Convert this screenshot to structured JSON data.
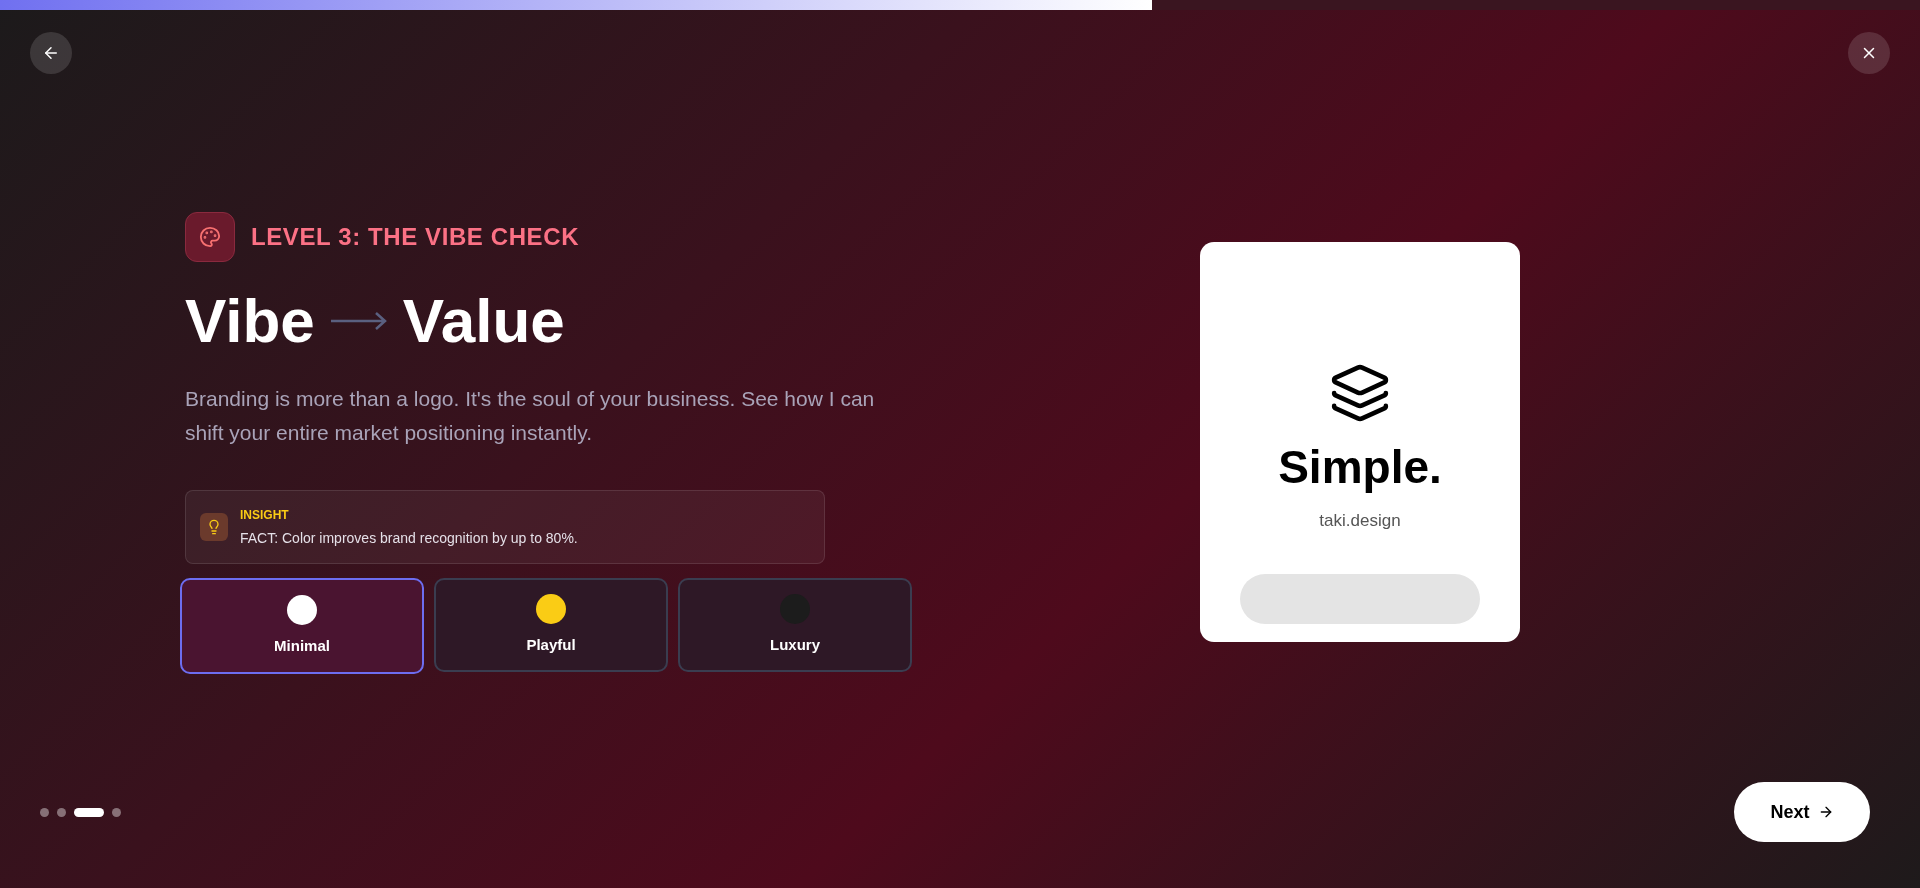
{
  "progress": {
    "level": 0.6
  },
  "level_label": "LEVEL 3: THE VIBE CHECK",
  "heading": {
    "from": "Vibe",
    "to": "Value"
  },
  "description": "Branding is more than a logo. It's the soul of your business. See how I can shift your entire market positioning instantly.",
  "insight": {
    "title": "INSIGHT",
    "text": "FACT: Color improves brand recognition by up to 80%."
  },
  "options": [
    {
      "label": "Minimal",
      "color": "#ffffff",
      "selected": true
    },
    {
      "label": "Playful",
      "color": "#facc15",
      "selected": false
    },
    {
      "label": "Luxury",
      "color": "#1c1c1c",
      "selected": false
    }
  ],
  "preview": {
    "title": "Simple.",
    "subtitle": "taki.design"
  },
  "steps": [
    {
      "selected": false
    },
    {
      "selected": false
    },
    {
      "selected": true
    },
    {
      "selected": false
    }
  ],
  "next_button": "Next"
}
